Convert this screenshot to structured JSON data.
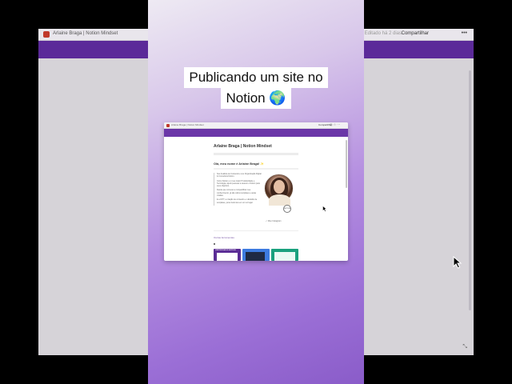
{
  "background_window": {
    "title": "Arlaine Braga | Notion Mindset",
    "right_text": "Editado há 2 dias",
    "share_label": "Compartilhar"
  },
  "caption": {
    "line1": "Publicando um site no",
    "line2": "Notion 🌍"
  },
  "inner_window": {
    "tab_title": "Arlaine Braga | Notion Mindset",
    "share_label": "Compartilhar",
    "page_title": "Arlaine Braga | Notion Mindset",
    "greeting": "Olá, meu nome é Arlaine Braga! ✨",
    "bio": [
      "Sou Analista de Conteúdo e sou Organização Digital & Consultora Notion.",
      "Como Notion é o meu maior Produtividade e Tecnologia, ajudo pessoas a usarem o Notion para seus objetivos.",
      "Desde que comecei a compartilhar meu conhecimento, já são vários templates e aulas criadas.",
      "E a OITT, a criação de conteúdo e o Estúdio de templates, juntei tudo isso em um só lugar."
    ],
    "seal_text": "NOTION",
    "verified_text": "✓ Meu Instagram",
    "other_label": "Outras ferramentas",
    "thumb1_label": "CERTIFICADOS NOTION"
  },
  "colors": {
    "brand_purple": "#6b36a8",
    "accent_purple": "#9b6fd6"
  }
}
